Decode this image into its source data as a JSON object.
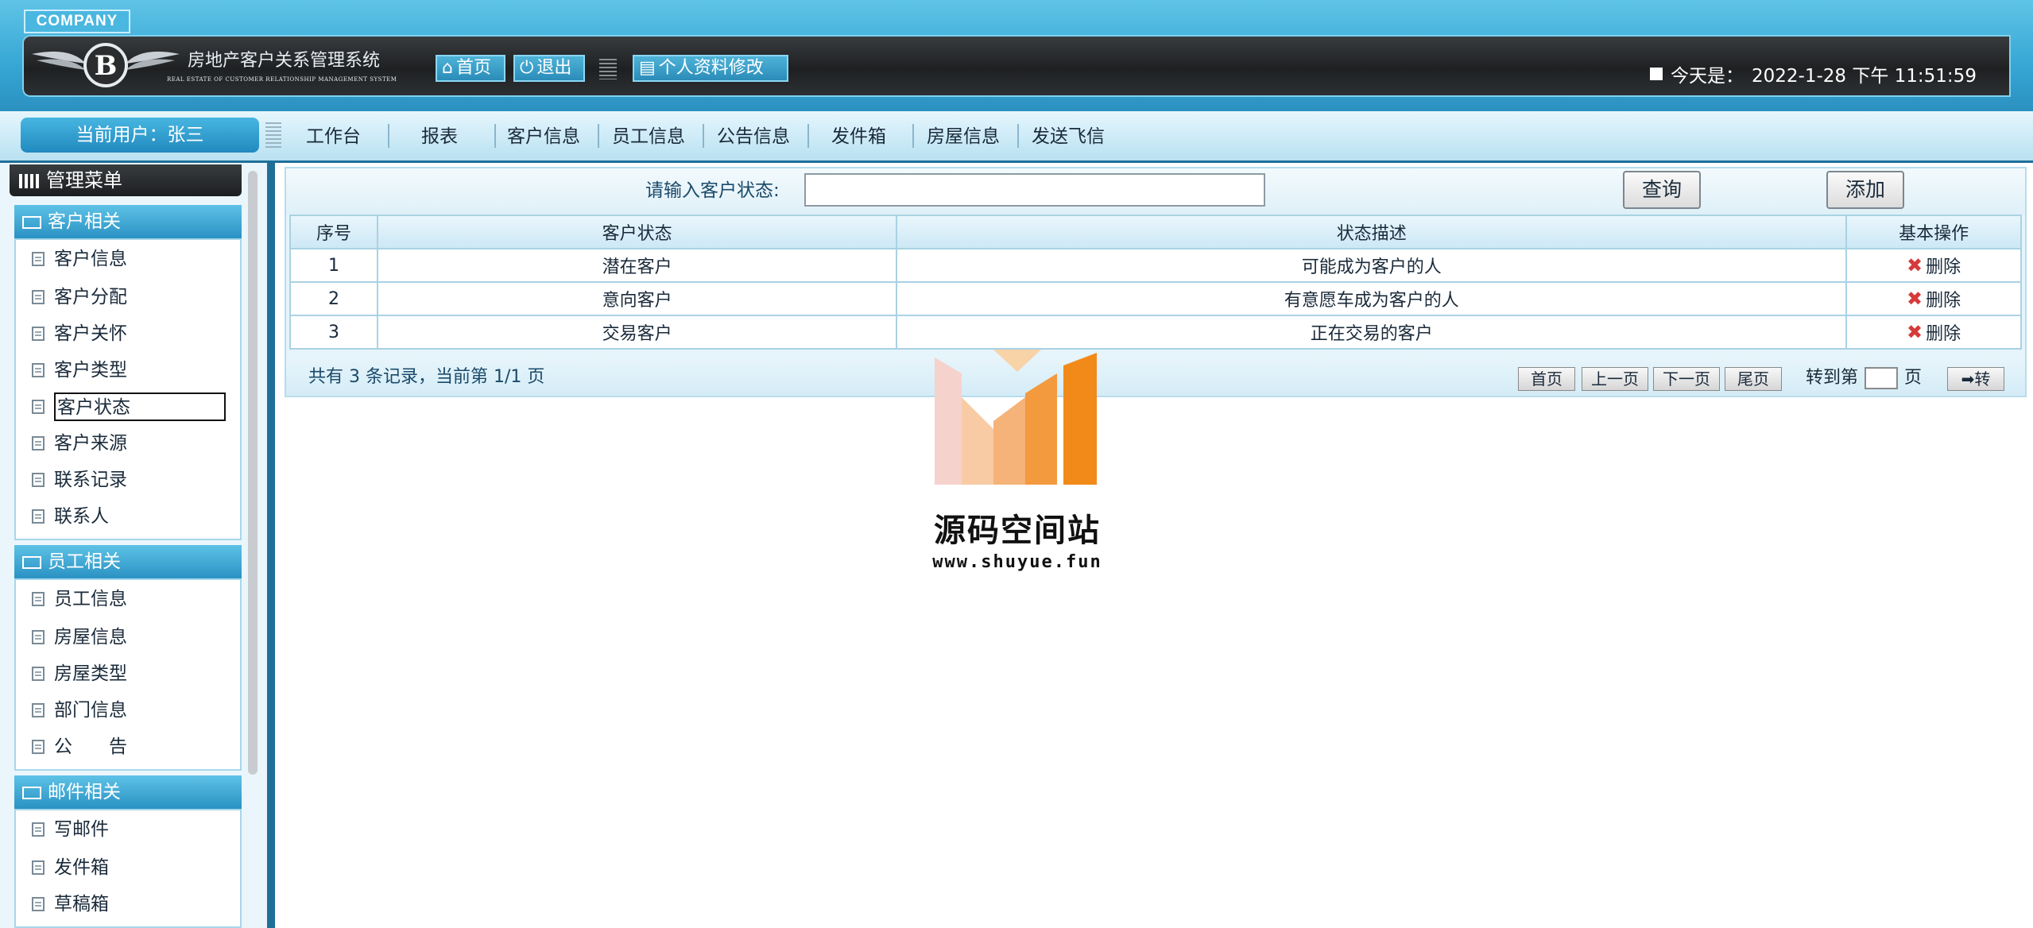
{
  "header": {
    "company": "COMPANY",
    "title": "房地产客户关系管理系统",
    "subtitle": "REAL ESTATE OF CUSTOMER RELATIONSHIP MANAGEMENT SYSTEM",
    "logo_letter": "B",
    "home_label": "首页",
    "logout_label": "退出",
    "profile_label": "个人资料修改",
    "today_label": "今天是：",
    "today_value": "2022-1-28 下午 11:51:59"
  },
  "nav": {
    "current_user": "当前用户：张三",
    "items": [
      "工作台",
      "报表",
      "客户信息",
      "员工信息",
      "公告信息",
      "发件箱",
      "房屋信息",
      "发送飞信"
    ]
  },
  "sidebar": {
    "menu_title": "管理菜单",
    "groups": [
      {
        "title": "客户相关",
        "items": [
          "客户信息",
          "客户分配",
          "客户关怀",
          "客户类型",
          "客户状态",
          "客户来源",
          "联系记录",
          "联系人"
        ]
      },
      {
        "title": "员工相关",
        "items": [
          "员工信息",
          "房屋信息",
          "房屋类型",
          "部门信息",
          "公　　告"
        ]
      },
      {
        "title": "邮件相关",
        "items": [
          "写邮件",
          "发件箱",
          "草稿箱"
        ]
      }
    ],
    "selected_item": "客户状态"
  },
  "search": {
    "label": "请输入客户状态:",
    "value": "",
    "query_button": "查询",
    "add_button": "添加"
  },
  "table": {
    "columns": [
      "序号",
      "客户状态",
      "状态描述",
      "基本操作"
    ],
    "rows": [
      {
        "id": "1",
        "status": "潜在客户",
        "desc": "可能成为客户的人",
        "action": "删除"
      },
      {
        "id": "2",
        "status": "意向客户",
        "desc": "有意愿车成为客户的人",
        "action": "删除"
      },
      {
        "id": "3",
        "status": "交易客户",
        "desc": "正在交易的客户",
        "action": "删除"
      }
    ]
  },
  "pager": {
    "summary": "共有 3 条记录，当前第 1/1 页",
    "first": "首页",
    "prev": "上一页",
    "next": "下一页",
    "last": "尾页",
    "goto_prefix": "转到第",
    "goto_suffix": "页",
    "goto_button": "➡转"
  },
  "watermark": {
    "name": "源码空间站",
    "url": "www.shuyue.fun"
  },
  "colors": {
    "header_blue": "#36a6d4",
    "header_dark": "#1e2022",
    "sidebar_head": "#2a92c4",
    "table_border": "#a9d2e4",
    "delete_red": "#d63a3a",
    "watermark_orange": "#f28a1a"
  }
}
